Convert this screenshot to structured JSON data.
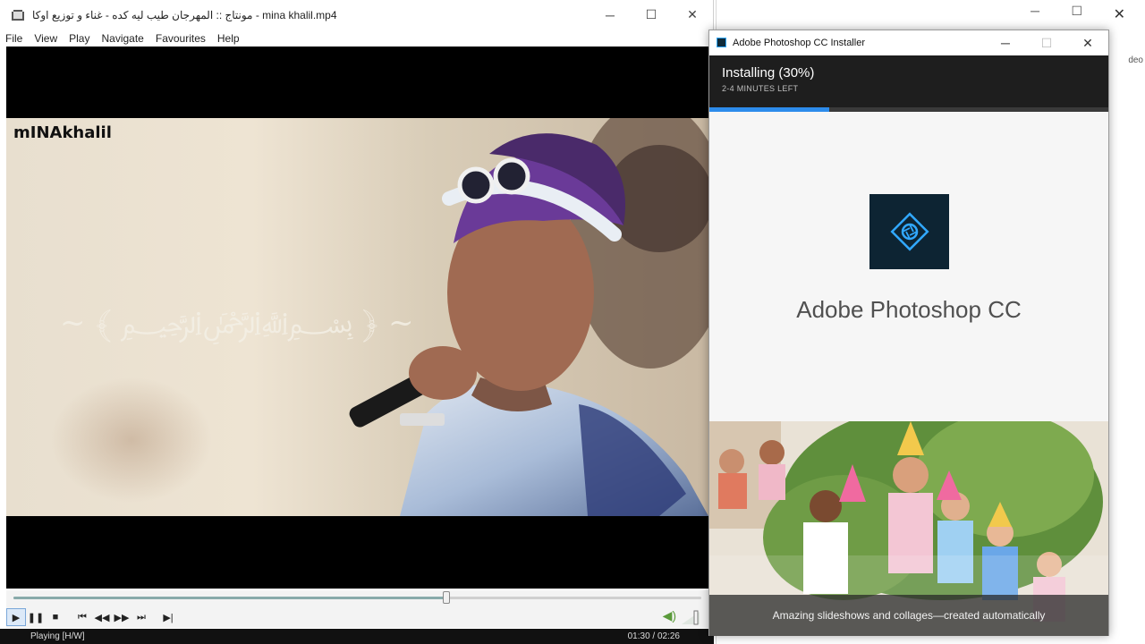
{
  "player": {
    "title": "مونتاج ::  المهرجان طيب ليه كده - غناء و توزيع اوكا - mina khalil.mp4",
    "window_controls": {
      "minimize": "─",
      "maximize": "☐",
      "close": "✕"
    },
    "menu": [
      "File",
      "View",
      "Play",
      "Navigate",
      "Favourites",
      "Help"
    ],
    "video_watermark": "mINAkhalil",
    "seek_progress": 0.63,
    "controls": {
      "play": "▶",
      "pause": "❚❚",
      "stop": "■",
      "prev": "⏮",
      "rewind": "◀◀",
      "forward": "▶▶",
      "next": "⏭",
      "frame_step": "▶|"
    },
    "status": {
      "state": "Playing [H/W]",
      "time": "01:30 / 02:26"
    }
  },
  "background_window": {
    "minimize": "─",
    "maximize": "☐",
    "close": "✕",
    "partial_text": "deo"
  },
  "installer": {
    "title": "Adobe Photoshop CC Installer",
    "window_controls": {
      "minimize": "─",
      "maximize": "☐",
      "close": "✕"
    },
    "status": "Installing (30%)",
    "time_left": "2-4 MINUTES LEFT",
    "progress": 0.3,
    "product_name": "Adobe Photoshop CC",
    "promo_caption": "Amazing slideshows and collages—created automatically",
    "colors": {
      "accent": "#2d8ceb",
      "header_bg": "#1e1e1e",
      "logo_bg": "#0d2433",
      "logo_stroke": "#31a8ff"
    }
  }
}
